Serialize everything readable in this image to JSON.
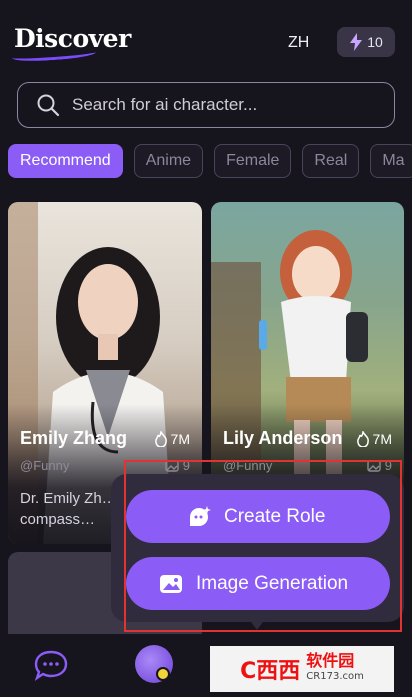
{
  "header": {
    "title": "Discover",
    "language": "ZH",
    "credits": "10"
  },
  "search": {
    "placeholder": "Search for ai character..."
  },
  "categories": [
    "Recommend",
    "Anime",
    "Female",
    "Real",
    "Ma"
  ],
  "cards": [
    {
      "name": "Emily Zhang",
      "likes": "7M",
      "tag": "@Funny",
      "count": "9",
      "description": "Dr. Emily Zh… the compass…"
    },
    {
      "name": "Lily Anderson",
      "likes": "7M",
      "tag": "@Funny",
      "count": "9"
    }
  ],
  "popup": {
    "create_role": "Create Role",
    "image_generation": "Image Generation"
  },
  "watermark": {
    "logo": "C西西",
    "name": "软件园",
    "url": "CR173.com"
  },
  "colors": {
    "accent": "#8b5cf6",
    "background": "#16141c",
    "highlight": "#e23232"
  }
}
